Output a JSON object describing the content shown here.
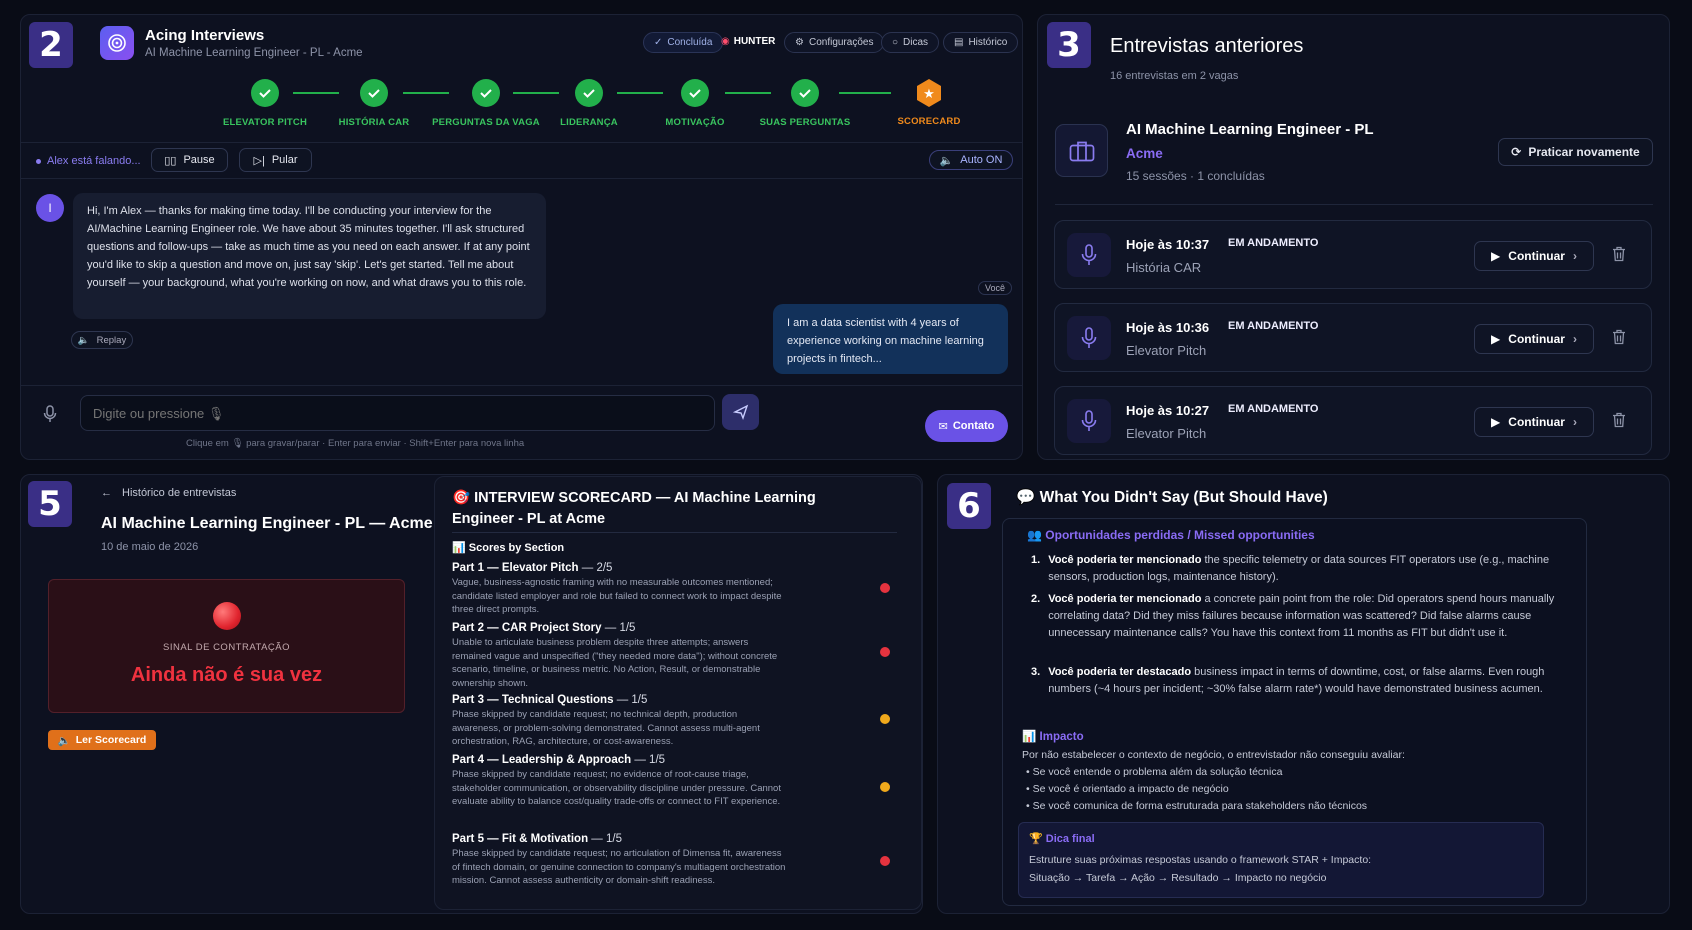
{
  "interview": {
    "badge": "2",
    "app_title": "Acing Interviews",
    "subtitle": "AI Machine Learning Engineer - PL - Acme",
    "header_buttons": {
      "completed": "Concluída",
      "hunter": "HUNTER",
      "settings": "Configurações",
      "tips": "Dicas",
      "history": "Histórico"
    },
    "steps": [
      {
        "label": "ELEVATOR PITCH"
      },
      {
        "label": "HISTÓRIA CAR"
      },
      {
        "label": "PERGUNTAS DA VAGA"
      },
      {
        "label": "LIDERANÇA"
      },
      {
        "label": "MOTIVAÇÃO"
      },
      {
        "label": "SUAS PERGUNTAS"
      },
      {
        "label": "SCORECARD"
      }
    ],
    "speaking": "Alex está falando...",
    "pause": "Pause",
    "skip": "Pular",
    "auto": "Auto ON",
    "avatar_initial": "I",
    "assistant_message": "Hi, I'm Alex — thanks for making time today. I'll be conducting your interview for the AI/Machine Learning Engineer role. We have about 35 minutes together. I'll ask structured questions and follow-ups — take as much time as you need on each answer. If at any point you'd like to skip a question and move on, just say 'skip'. Let's get started. Tell me about yourself — your background, what you're working on now, and what draws you to this role.",
    "replay": "Replay",
    "you_label": "Você",
    "user_message": "I am a data scientist with 4 years of experience working on machine learning projects in fintech...",
    "input_placeholder": "Digite ou pressione 🎙",
    "hint": "Clique em 🎙 para gravar/parar · Enter para enviar · Shift+Enter para nova linha",
    "contact": "Contato"
  },
  "previous": {
    "badge": "3",
    "title": "Entrevistas anteriores",
    "subtitle": "16 entrevistas em 2 vagas",
    "job_title": "AI Machine Learning Engineer - PL",
    "company": "Acme",
    "meta": "15 sessões · 1 concluídas",
    "practice_again": "Praticar novamente",
    "sessions": [
      {
        "time": "Hoje às 10:37",
        "status": "EM ANDAMENTO",
        "section": "História CAR",
        "action": "Continuar"
      },
      {
        "time": "Hoje às 10:36",
        "status": "EM ANDAMENTO",
        "section": "Elevator Pitch",
        "action": "Continuar"
      },
      {
        "time": "Hoje às 10:27",
        "status": "EM ANDAMENTO",
        "section": "Elevator Pitch",
        "action": "Continuar"
      }
    ]
  },
  "history": {
    "badge": "5",
    "back_label": "Histórico de entrevistas",
    "title": "AI Machine Learning Engineer - PL — Acme",
    "date": "10 de maio de 2026",
    "signal_label": "SINAL DE CONTRATAÇÃO",
    "signal_value": "Ainda não é sua vez",
    "read_scorecard": "Ler Scorecard"
  },
  "scorecard": {
    "title_icon": "🎯",
    "title": "INTERVIEW SCORECARD — AI Machine Learning Engineer - PL at Acme",
    "section_icon": "📊",
    "section_title": "Scores by Section",
    "parts": [
      {
        "name": "Part 1 — Elevator Pitch",
        "score": "— 2/5",
        "desc": "Vague, business-agnostic framing with no measurable outcomes mentioned; candidate listed employer and role but failed to connect work to impact despite three direct prompts.",
        "color": "#e5333f"
      },
      {
        "name": "Part 2 — CAR Project Story",
        "score": "— 1/5",
        "desc": "Unable to articulate business problem despite three attempts; answers remained vague and unspecified (\"they needed more data\"); without concrete scenario, timeline, or business metric. No Action, Result, or demonstrable ownership shown.",
        "color": "#e5333f"
      },
      {
        "name": "Part 3 — Technical Questions",
        "score": "— 1/5",
        "desc": "Phase skipped by candidate request; no technical depth, production awareness, or problem-solving demonstrated. Cannot assess multi-agent orchestration, RAG, architecture, or cost-awareness.",
        "color": "#f0a91c"
      },
      {
        "name": "Part 4 — Leadership & Approach",
        "score": "— 1/5",
        "desc": "Phase skipped by candidate request; no evidence of root-cause triage, stakeholder communication, or observability discipline under pressure. Cannot evaluate ability to balance cost/quality trade-offs or connect to FIT experience.",
        "color": "#f0a91c"
      },
      {
        "name": "Part 5 — Fit & Motivation",
        "score": "— 1/5",
        "desc": "Phase skipped by candidate request; no articulation of Dimensa fit, awareness of fintech domain, or genuine connection to company's multiagent orchestration mission. Cannot assess authenticity or domain-shift readiness.",
        "color": "#e5333f"
      }
    ]
  },
  "feedback": {
    "badge": "6",
    "title_icon": "💬",
    "title": "What You Didn't Say (But Should Have)",
    "missed_title": "Oportunidades perdidas / Missed opportunities",
    "missed": [
      {
        "n": "1.",
        "lead": "Você poderia ter mencionado",
        "text": " the specific telemetry or data sources FIT operators use (e.g., machine sensors, production logs, maintenance history)."
      },
      {
        "n": "2.",
        "lead": "Você poderia ter mencionado",
        "text": " a concrete pain point from the role: Did operators spend hours manually correlating data? Did they miss failures because information was scattered? Did false alarms cause unnecessary maintenance calls? You have this context from 11 months as FIT but didn't use it."
      },
      {
        "n": "3.",
        "lead": "Você poderia ter destacado",
        "text": " business impact in terms of downtime, cost, or false alarms. Even rough numbers (~4 hours per incident; ~30% false alarm rate*) would have demonstrated business acumen."
      }
    ],
    "impact_title": "Impacto",
    "impact_intro": "Por não estabelecer o contexto de negócio, o entrevistador não conseguiu avaliar:",
    "impact_items": [
      "Se você entende o problema além da solução técnica",
      "Se você é orientado a impacto de negócio",
      "Se você comunica de forma estruturada para stakeholders não técnicos"
    ],
    "tip_title": "Dica final",
    "tip_line1": "Estruture suas próximas respostas usando o framework STAR + Impacto:",
    "tip_line2": "Situação → Tarefa → Ação → Resultado → Impacto no negócio"
  },
  "colors": {
    "accent": "#7c5cf0",
    "success": "#22b04b",
    "warning": "#f08a1c",
    "danger": "#e5333f"
  }
}
